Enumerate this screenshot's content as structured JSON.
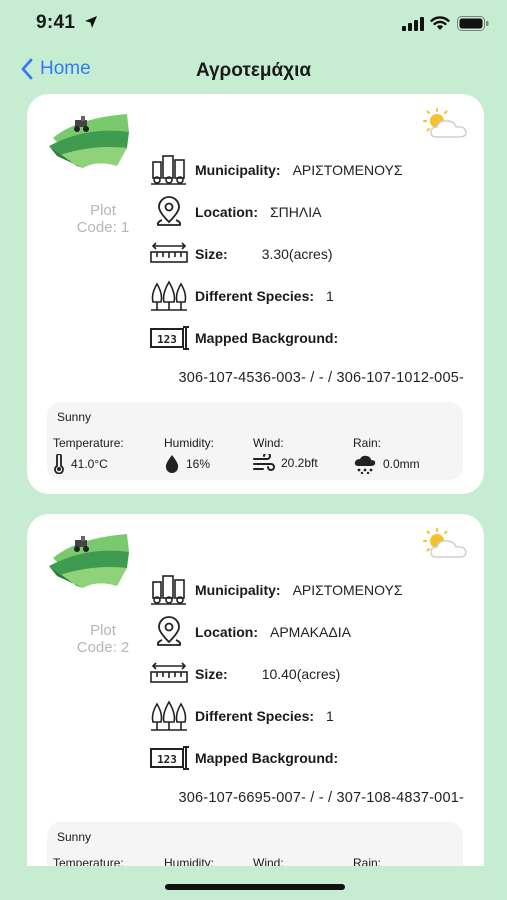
{
  "status_bar": {
    "time": "9:41"
  },
  "nav": {
    "back_label": "Home",
    "title": "Αγροτεμάχια"
  },
  "labels": {
    "municipality": "Municipality:",
    "location": "Location:",
    "size": "Size:",
    "species": "Different Species:",
    "mapped": "Mapped Background:",
    "temperature": "Temperature:",
    "humidity": "Humidity:",
    "wind": "Wind:",
    "rain": "Rain:"
  },
  "plots": [
    {
      "code_line1": "Plot",
      "code_line2": "Code: 1",
      "municipality": "ΑΡΙΣΤΟΜΕΝΟΥΣ",
      "location": "ΣΠΗΛΙΑ",
      "size": "3.30(acres)",
      "species": "1",
      "mapped_codes": "306-107-4536-003- / - / 306-107-1012-005-",
      "weather": {
        "condition": "Sunny",
        "temperature": "41.0°C",
        "humidity": "16%",
        "wind": "20.2bft",
        "rain": "0.0mm"
      }
    },
    {
      "code_line1": "Plot",
      "code_line2": "Code: 2",
      "municipality": "ΑΡΙΣΤΟΜΕΝΟΥΣ",
      "location": "ΑΡΜΑΚΑΔΙΑ",
      "size": "10.40(acres)",
      "species": "1",
      "mapped_codes": "306-107-6695-007- / - / 307-108-4837-001-",
      "weather": {
        "condition": "Sunny",
        "temperature": "",
        "humidity": "",
        "wind": "",
        "rain": ""
      }
    }
  ]
}
